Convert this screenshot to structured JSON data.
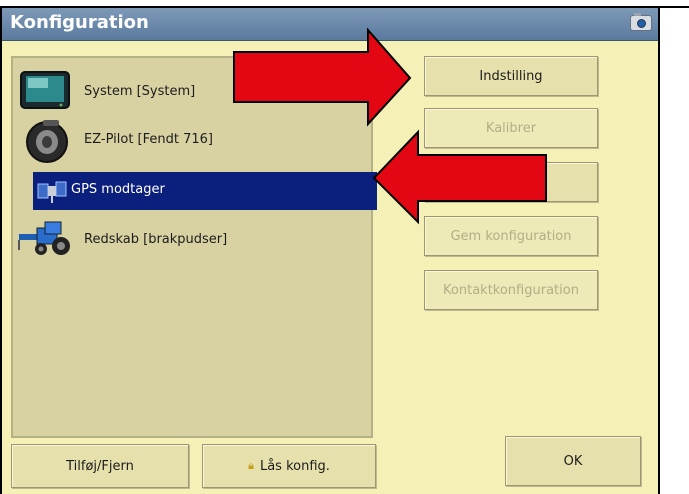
{
  "window": {
    "title": "Konfiguration",
    "camera_icon": "camera-icon"
  },
  "list": {
    "items": [
      {
        "label": "System [System]",
        "icon": "display-monitor-icon"
      },
      {
        "label": "EZ-Pilot [Fendt 716]",
        "icon": "steering-wheel-icon"
      },
      {
        "label": "GPS modtager",
        "icon": "satellite-icon",
        "selected": true
      },
      {
        "label": "Redskab [brakpudser]",
        "icon": "tractor-icon"
      }
    ]
  },
  "buttons": {
    "indstilling": "Indstilling",
    "kalibrer": "Kalibrer",
    "gem": "Gem konfiguration",
    "kontakt": "Kontaktkonfiguration",
    "tilfoj": "Tilføj/Fjern",
    "laas": "Lås konfig.",
    "ok": "OK"
  },
  "annotations": {
    "color": "#e30613"
  }
}
